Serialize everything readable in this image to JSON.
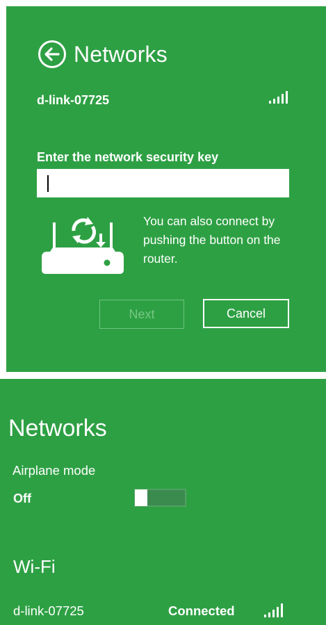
{
  "connect_dialog": {
    "title": "Networks",
    "network_name": "d-link-07725",
    "signal_icon": "wifi-signal-bars-icon",
    "key_label": "Enter the network security key",
    "key_value": "",
    "wps_text": "You can also connect by pushing the button on the router.",
    "router_icon": "wps-router-icon",
    "next_label": "Next",
    "cancel_label": "Cancel"
  },
  "networks_panel": {
    "title": "Networks",
    "airplane_mode_label": "Airplane mode",
    "airplane_mode_state": "Off",
    "wifi_heading": "Wi-Fi",
    "network_name": "d-link-07725",
    "status": "Connected",
    "signal_icon": "wifi-signal-bars-icon"
  },
  "colors": {
    "background_green": "#2ea044",
    "text": "#ffffff",
    "disabled": "#75c884"
  }
}
